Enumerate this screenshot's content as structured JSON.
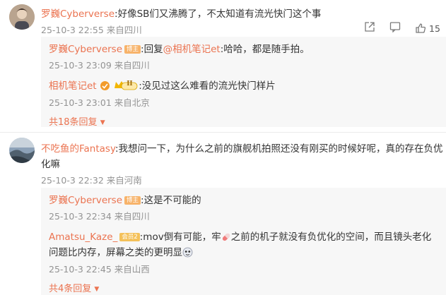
{
  "comments": [
    {
      "author": "罗巍Cyberverse",
      "text": ":好像SB们又沸腾了，不太知道有流光快门这个事",
      "time": "25-10-3 22:55",
      "location": "来自四川",
      "like_count": "15",
      "replies": [
        {
          "author": "罗巍Cyberverse",
          "badge": "博主",
          "text_prefix": ":回复",
          "mention": "@相机笔记et",
          "text_suffix": ":哈哈，都是随手拍。",
          "time": "25-10-3 23:09",
          "location": "来自四川"
        },
        {
          "author": "相机笔记et",
          "badge_level": "II",
          "text": ":没见过这么难看的流光快门样片",
          "time": "25-10-3 23:01",
          "location": "来自北京"
        }
      ],
      "more_label": "共18条回复"
    },
    {
      "author": "不吃鱼的Fantasy",
      "text_line1": ":我想问一下，为什么之前的旗舰机拍照还没有刚买的时候好呢，真的存在负优",
      "text_line2": "化嘛",
      "time": "25-10-3 22:32",
      "location": "来自河南",
      "replies": [
        {
          "author": "罗巍Cyberverse",
          "badge": "博主",
          "text": ":这是不可能的",
          "time": "25-10-3 22:34",
          "location": "来自四川"
        },
        {
          "author": "Amatsu_Kaze_",
          "badge": "会员2",
          "text_a": ":mov倒有可能，牢",
          "text_b": "之前的机子就没有负优化的空间，而且镜头老化",
          "text_line2": "问题比内存，屏幕之类的更明显",
          "time": "25-10-3 22:45",
          "location": "来自山西"
        }
      ],
      "more_label": "共4条回复"
    }
  ],
  "colors": {
    "name": "#eb7350",
    "meta": "#939393",
    "reply_bg": "#f7f7f7",
    "host_badge": "#f7b36a"
  }
}
